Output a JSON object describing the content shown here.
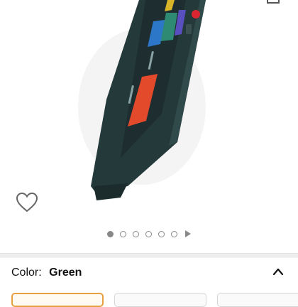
{
  "product": {
    "color_label": "Color:",
    "color_value": "Green"
  },
  "gallery": {
    "image_count": 6,
    "active_index": 0
  },
  "icons": [
    "share-icon",
    "heart-icon",
    "chevron-up-icon",
    "play-icon"
  ]
}
